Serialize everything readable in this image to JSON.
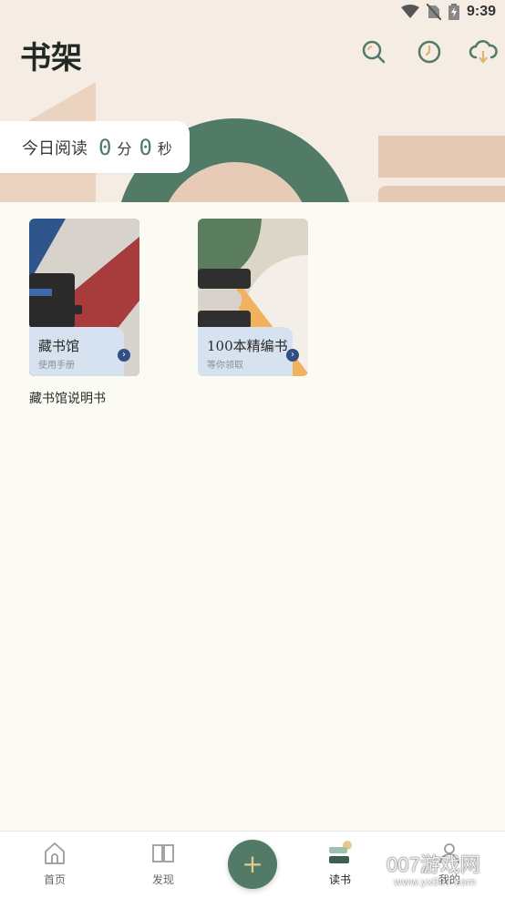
{
  "status": {
    "time": "9:39"
  },
  "header": {
    "title": "书架"
  },
  "reading": {
    "label": "今日阅读",
    "minutes": "0",
    "minute_unit": "分",
    "seconds": "0",
    "second_unit": "秒"
  },
  "books": [
    {
      "name": "藏书馆",
      "subtitle": "使用手册",
      "caption": "藏书馆说明书"
    },
    {
      "name": "100本精编书",
      "subtitle": "等你领取"
    }
  ],
  "tabs": [
    {
      "label": "首页",
      "icon": "home-icon"
    },
    {
      "label": "发现",
      "icon": "book-open-icon"
    },
    {
      "label": "读书",
      "icon": "books-icon"
    },
    {
      "label": "我的",
      "icon": "profile-icon"
    }
  ],
  "watermark": {
    "text": "007游戏网",
    "url": "www.yx007.com"
  },
  "colors": {
    "accent": "#517a67",
    "header_bg": "#f5ece4",
    "page_bg": "#fbfbf4",
    "gold": "#e8c98a"
  }
}
